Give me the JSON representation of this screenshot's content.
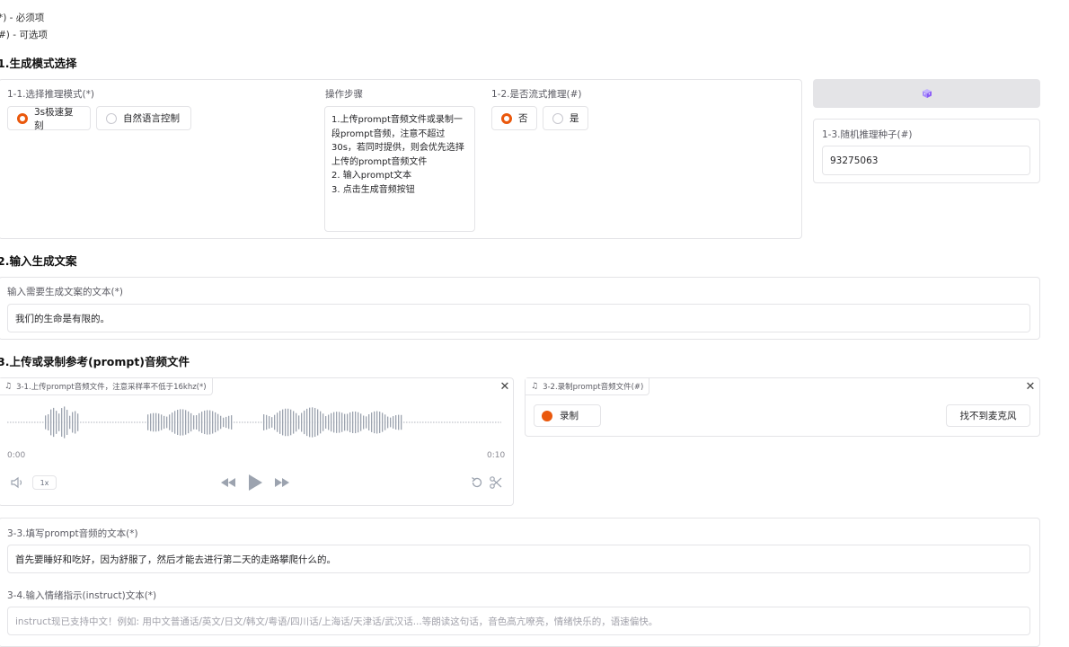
{
  "legend": {
    "required": "*) - 必须项",
    "optional": "#) - 可选项"
  },
  "section1": {
    "title": "1.生成模式选择",
    "mode_label": "1-1.选择推理模式(*)",
    "mode_options": [
      "3s极速复刻",
      "自然语言控制"
    ],
    "mode_selected": "3s极速复刻",
    "steps_label": "操作步骤",
    "steps_text": "1.上传prompt音频文件或录制一段prompt音频，注意不超过30s，若同时提供，则会优先选择上传的prompt音频文件\n2. 输入prompt文本\n3. 点击生成音频按钮",
    "stream_label": "1-2.是否流式推理(#)",
    "stream_options": [
      "否",
      "是"
    ],
    "stream_selected": "否",
    "seed_button_icon": "dice-icon",
    "seed_label": "1-3.随机推理种子(#)",
    "seed_value": "93275063"
  },
  "section2": {
    "title": "2.输入生成文案",
    "text_label": "输入需要生成文案的文本(*)",
    "text_value": "我们的生命是有限的。"
  },
  "section3": {
    "title": "3.上传或录制参考(prompt)音频文件",
    "upload_label": "3-1.上传prompt音频文件，注意采样率不低于16khz(*)",
    "time_start": "0:00",
    "time_end": "0:10",
    "speed": "1x",
    "record_label": "3-2.录制prompt音频文件(#)",
    "record_button": "录制",
    "mic_button": "找不到麦克风",
    "prompt_text_label": "3-3.填写prompt音频的文本(*)",
    "prompt_text_value": "首先要睡好和吃好，因为舒服了，然后才能去进行第二天的走路攀爬什么的。",
    "instruct_label": "3-4.输入情绪指示(instruct)文本(*)",
    "instruct_placeholder": "instruct现已支持中文！例如: 用中文普通话/英文/日文/韩文/粤语/四川话/上海话/天津话/武汉话...等朗读这句话，音色高亢嘹亮，情绪快乐的，语速偏快。"
  },
  "colors": {
    "accent": "#ea580c",
    "border": "#e4e4e7",
    "wave": "#9ca3af"
  }
}
